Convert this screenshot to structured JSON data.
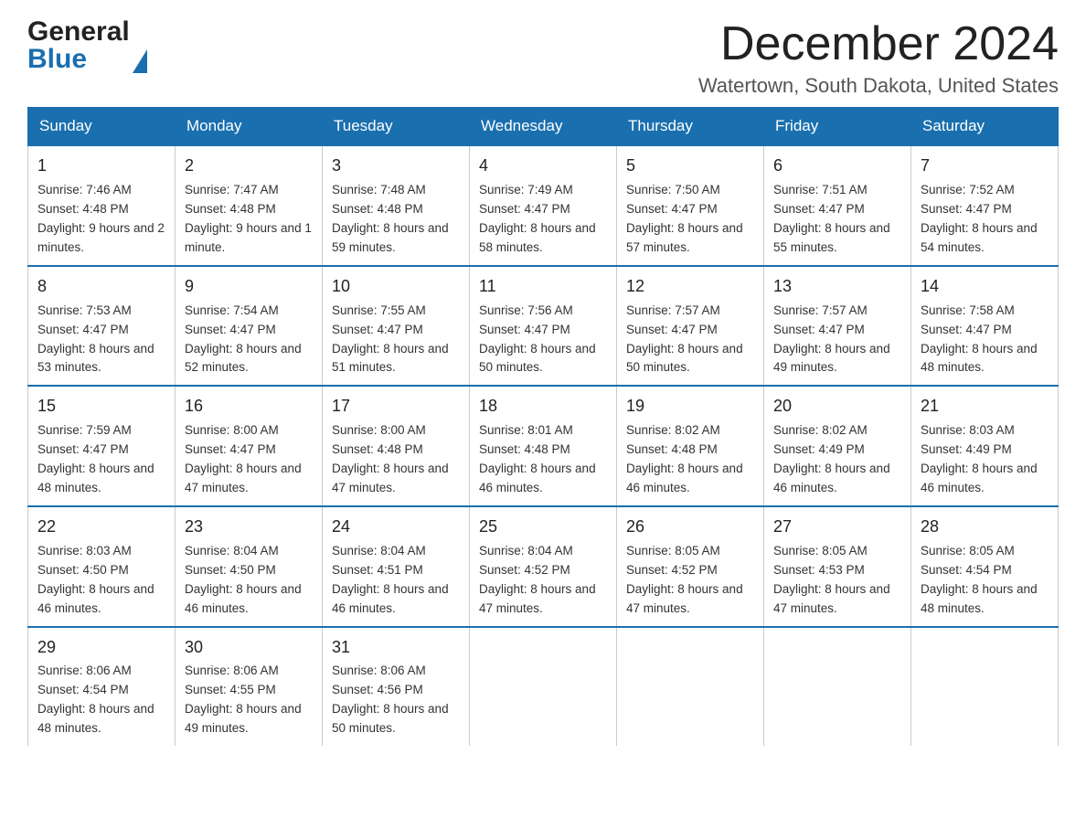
{
  "header": {
    "month_year": "December 2024",
    "location": "Watertown, South Dakota, United States",
    "logo_general": "General",
    "logo_blue": "Blue"
  },
  "weekdays": [
    "Sunday",
    "Monday",
    "Tuesday",
    "Wednesday",
    "Thursday",
    "Friday",
    "Saturday"
  ],
  "weeks": [
    [
      {
        "day": "1",
        "sunrise": "Sunrise: 7:46 AM",
        "sunset": "Sunset: 4:48 PM",
        "daylight": "Daylight: 9 hours and 2 minutes."
      },
      {
        "day": "2",
        "sunrise": "Sunrise: 7:47 AM",
        "sunset": "Sunset: 4:48 PM",
        "daylight": "Daylight: 9 hours and 1 minute."
      },
      {
        "day": "3",
        "sunrise": "Sunrise: 7:48 AM",
        "sunset": "Sunset: 4:48 PM",
        "daylight": "Daylight: 8 hours and 59 minutes."
      },
      {
        "day": "4",
        "sunrise": "Sunrise: 7:49 AM",
        "sunset": "Sunset: 4:47 PM",
        "daylight": "Daylight: 8 hours and 58 minutes."
      },
      {
        "day": "5",
        "sunrise": "Sunrise: 7:50 AM",
        "sunset": "Sunset: 4:47 PM",
        "daylight": "Daylight: 8 hours and 57 minutes."
      },
      {
        "day": "6",
        "sunrise": "Sunrise: 7:51 AM",
        "sunset": "Sunset: 4:47 PM",
        "daylight": "Daylight: 8 hours and 55 minutes."
      },
      {
        "day": "7",
        "sunrise": "Sunrise: 7:52 AM",
        "sunset": "Sunset: 4:47 PM",
        "daylight": "Daylight: 8 hours and 54 minutes."
      }
    ],
    [
      {
        "day": "8",
        "sunrise": "Sunrise: 7:53 AM",
        "sunset": "Sunset: 4:47 PM",
        "daylight": "Daylight: 8 hours and 53 minutes."
      },
      {
        "day": "9",
        "sunrise": "Sunrise: 7:54 AM",
        "sunset": "Sunset: 4:47 PM",
        "daylight": "Daylight: 8 hours and 52 minutes."
      },
      {
        "day": "10",
        "sunrise": "Sunrise: 7:55 AM",
        "sunset": "Sunset: 4:47 PM",
        "daylight": "Daylight: 8 hours and 51 minutes."
      },
      {
        "day": "11",
        "sunrise": "Sunrise: 7:56 AM",
        "sunset": "Sunset: 4:47 PM",
        "daylight": "Daylight: 8 hours and 50 minutes."
      },
      {
        "day": "12",
        "sunrise": "Sunrise: 7:57 AM",
        "sunset": "Sunset: 4:47 PM",
        "daylight": "Daylight: 8 hours and 50 minutes."
      },
      {
        "day": "13",
        "sunrise": "Sunrise: 7:57 AM",
        "sunset": "Sunset: 4:47 PM",
        "daylight": "Daylight: 8 hours and 49 minutes."
      },
      {
        "day": "14",
        "sunrise": "Sunrise: 7:58 AM",
        "sunset": "Sunset: 4:47 PM",
        "daylight": "Daylight: 8 hours and 48 minutes."
      }
    ],
    [
      {
        "day": "15",
        "sunrise": "Sunrise: 7:59 AM",
        "sunset": "Sunset: 4:47 PM",
        "daylight": "Daylight: 8 hours and 48 minutes."
      },
      {
        "day": "16",
        "sunrise": "Sunrise: 8:00 AM",
        "sunset": "Sunset: 4:47 PM",
        "daylight": "Daylight: 8 hours and 47 minutes."
      },
      {
        "day": "17",
        "sunrise": "Sunrise: 8:00 AM",
        "sunset": "Sunset: 4:48 PM",
        "daylight": "Daylight: 8 hours and 47 minutes."
      },
      {
        "day": "18",
        "sunrise": "Sunrise: 8:01 AM",
        "sunset": "Sunset: 4:48 PM",
        "daylight": "Daylight: 8 hours and 46 minutes."
      },
      {
        "day": "19",
        "sunrise": "Sunrise: 8:02 AM",
        "sunset": "Sunset: 4:48 PM",
        "daylight": "Daylight: 8 hours and 46 minutes."
      },
      {
        "day": "20",
        "sunrise": "Sunrise: 8:02 AM",
        "sunset": "Sunset: 4:49 PM",
        "daylight": "Daylight: 8 hours and 46 minutes."
      },
      {
        "day": "21",
        "sunrise": "Sunrise: 8:03 AM",
        "sunset": "Sunset: 4:49 PM",
        "daylight": "Daylight: 8 hours and 46 minutes."
      }
    ],
    [
      {
        "day": "22",
        "sunrise": "Sunrise: 8:03 AM",
        "sunset": "Sunset: 4:50 PM",
        "daylight": "Daylight: 8 hours and 46 minutes."
      },
      {
        "day": "23",
        "sunrise": "Sunrise: 8:04 AM",
        "sunset": "Sunset: 4:50 PM",
        "daylight": "Daylight: 8 hours and 46 minutes."
      },
      {
        "day": "24",
        "sunrise": "Sunrise: 8:04 AM",
        "sunset": "Sunset: 4:51 PM",
        "daylight": "Daylight: 8 hours and 46 minutes."
      },
      {
        "day": "25",
        "sunrise": "Sunrise: 8:04 AM",
        "sunset": "Sunset: 4:52 PM",
        "daylight": "Daylight: 8 hours and 47 minutes."
      },
      {
        "day": "26",
        "sunrise": "Sunrise: 8:05 AM",
        "sunset": "Sunset: 4:52 PM",
        "daylight": "Daylight: 8 hours and 47 minutes."
      },
      {
        "day": "27",
        "sunrise": "Sunrise: 8:05 AM",
        "sunset": "Sunset: 4:53 PM",
        "daylight": "Daylight: 8 hours and 47 minutes."
      },
      {
        "day": "28",
        "sunrise": "Sunrise: 8:05 AM",
        "sunset": "Sunset: 4:54 PM",
        "daylight": "Daylight: 8 hours and 48 minutes."
      }
    ],
    [
      {
        "day": "29",
        "sunrise": "Sunrise: 8:06 AM",
        "sunset": "Sunset: 4:54 PM",
        "daylight": "Daylight: 8 hours and 48 minutes."
      },
      {
        "day": "30",
        "sunrise": "Sunrise: 8:06 AM",
        "sunset": "Sunset: 4:55 PM",
        "daylight": "Daylight: 8 hours and 49 minutes."
      },
      {
        "day": "31",
        "sunrise": "Sunrise: 8:06 AM",
        "sunset": "Sunset: 4:56 PM",
        "daylight": "Daylight: 8 hours and 50 minutes."
      },
      null,
      null,
      null,
      null
    ]
  ]
}
